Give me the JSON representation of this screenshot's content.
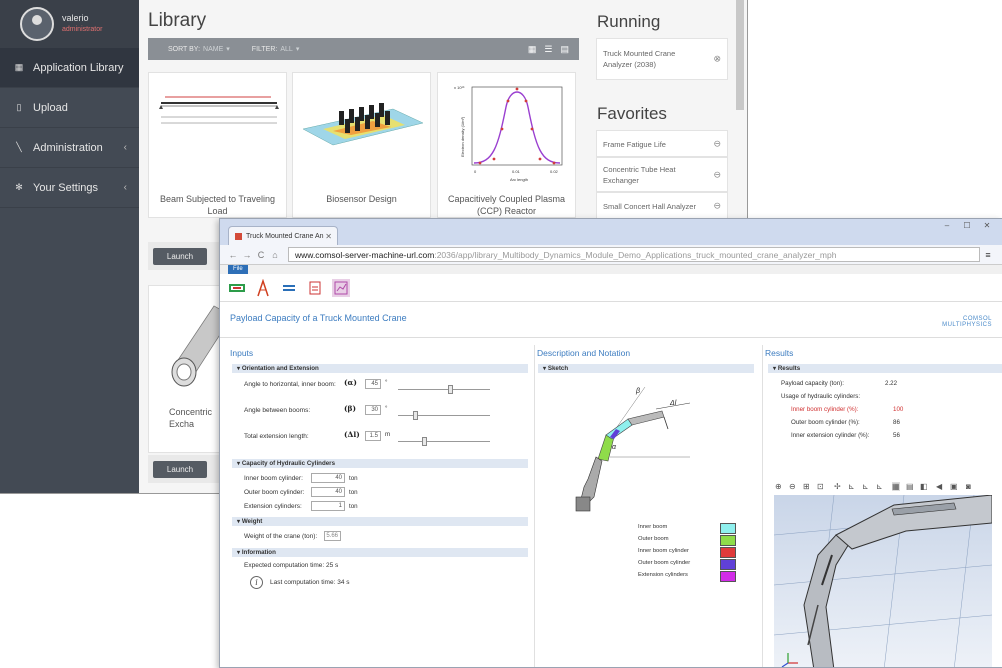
{
  "server": {
    "user": {
      "name": "valerio",
      "role": "administrator"
    },
    "nav": [
      {
        "label": "Application Library",
        "icon": "grid-icon",
        "active": true
      },
      {
        "label": "Upload",
        "icon": "upload-icon"
      },
      {
        "label": "Administration",
        "icon": "wrench-icon",
        "chevron": "‹"
      },
      {
        "label": "Your Settings",
        "icon": "gear-icon",
        "chevron": "‹"
      }
    ],
    "library_title": "Library",
    "sort_label": "SORT BY:",
    "sort_value": "NAME",
    "filter_label": "FILTER:",
    "filter_value": "ALL",
    "apps": [
      {
        "title": "Beam Subjected to Traveling Load"
      },
      {
        "title": "Biosensor Design"
      },
      {
        "title": "Capacitively Coupled Plasma (CCP) Reactor"
      },
      {
        "title": "Concentric Tube Heat Exchanger",
        "title_visible": "Concentric\nExcha"
      }
    ],
    "launch_label": "Launch",
    "running_title": "Running",
    "running": [
      {
        "label": "Truck Mounted Crane Analyzer (2038)"
      }
    ],
    "favorites_title": "Favorites",
    "favorites": [
      {
        "label": "Frame Fatigue Life"
      },
      {
        "label": "Concentric Tube Heat Exchanger"
      },
      {
        "label": "Small Concert Hall Analyzer"
      }
    ],
    "plasma_axes": {
      "ylabel": "Electron density (1/m³)",
      "xlabel": "Arc length",
      "ytick": "x 10¹⁶",
      "xticks": [
        "0",
        "0.01",
        "0.02"
      ]
    }
  },
  "browser": {
    "tab_title": "Truck Mounted Crane An",
    "url_host": "www.comsol-server-machine-url.com",
    "url_path": ":2036/app/library_Multibody_Dynamics_Module_Demo_Applications_truck_mounted_crane_analyzer_mph",
    "file_tab": "File",
    "app_title": "Payload Capacity of a Truck Mounted Crane",
    "logo": [
      "COMSOL",
      "MULTIPHYSICS"
    ],
    "inputs": {
      "heading": "Inputs",
      "orientation": {
        "title": "Orientation and Extension",
        "rows": [
          {
            "label": "Angle to horizontal, inner boom:",
            "symbol": "(α)",
            "value": "45",
            "unit": "°"
          },
          {
            "label": "Angle between booms:",
            "symbol": "(β)",
            "value": "30",
            "unit": "°"
          },
          {
            "label": "Total extension length:",
            "symbol": "(Δl)",
            "value": "1.5",
            "unit": "m"
          }
        ]
      },
      "capacity": {
        "title": "Capacity of Hydraulic Cylinders",
        "rows": [
          {
            "label": "Inner boom cylinder:",
            "value": "40",
            "unit": "ton"
          },
          {
            "label": "Outer boom cylinder:",
            "value": "40",
            "unit": "ton"
          },
          {
            "label": "Extension cylinders:",
            "value": "1",
            "unit": "ton"
          }
        ]
      },
      "weight": {
        "title": "Weight",
        "label": "Weight of the crane (ton):",
        "value": "5.66"
      },
      "information": {
        "title": "Information",
        "expected": "Expected computation time: 25 s",
        "last": "Last computation time: 34 s"
      }
    },
    "description": {
      "heading": "Description and Notation",
      "sketch_title": "Sketch",
      "legend": [
        "Inner boom",
        "Outer boom",
        "Inner boom cylinder",
        "Outer boom cylinder",
        "Extension cylinders"
      ],
      "legend_colors": [
        "#8ff0ee",
        "#8fdc4a",
        "#e03a3a",
        "#6040d8",
        "#d22ce8"
      ]
    },
    "results": {
      "heading": "Results",
      "title": "Results",
      "payload_label": "Payload capacity (ton):",
      "payload_value": "2.22",
      "usage_label": "Usage of hydraulic cylinders:",
      "rows": [
        {
          "label": "Inner boom cylinder (%):",
          "value": "100",
          "highlight": true
        },
        {
          "label": "Outer boom cylinder (%):",
          "value": "86"
        },
        {
          "label": "Inner extension cylinder (%):",
          "value": "56"
        }
      ]
    }
  }
}
